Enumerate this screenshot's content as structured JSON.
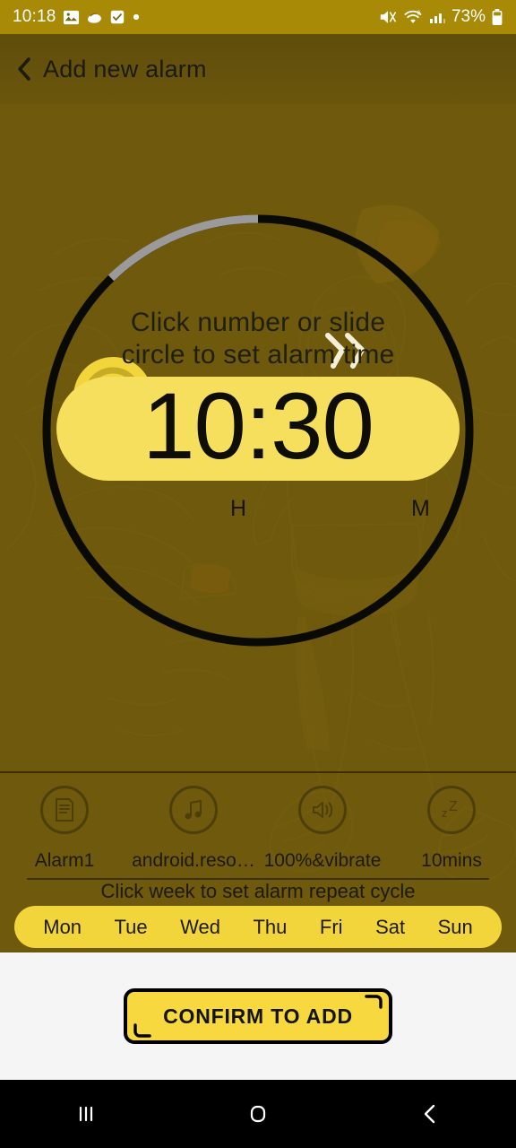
{
  "statusbar": {
    "clock": "10:18",
    "battery": "73%",
    "icons_left": [
      "image-icon",
      "app-icon",
      "checkbox-icon",
      "dot-icon"
    ],
    "icons_right": [
      "mute-icon",
      "wifi-icon",
      "signal-icon",
      "battery-icon"
    ]
  },
  "appbar": {
    "back_icon": "back-chevron-icon",
    "title": "Add new alarm"
  },
  "dial": {
    "hint_line1": "Click number or slide",
    "hint_line2": "circle to set alarm time",
    "time": "10:30",
    "hour_label": "H",
    "minute_label": "M",
    "handle_icon": "dial-handle-knob",
    "direction_icon": "double-chevron-icon",
    "track_color": "#0a0a05",
    "progress_color": "#9a9a9a",
    "knob_color": "#f2d53a",
    "pill_color": "#f5df5c"
  },
  "options": [
    {
      "icon": "document-icon",
      "label": "Alarm1"
    },
    {
      "icon": "music-note-icon",
      "label": "android.reso…"
    },
    {
      "icon": "volume-icon",
      "label": "100%&vibrate"
    },
    {
      "icon": "snooze-zzz-icon",
      "label": "10mins"
    }
  ],
  "week": {
    "hint": "Click week to set alarm repeat cycle",
    "days": [
      "Mon",
      "Tue",
      "Wed",
      "Thu",
      "Fri",
      "Sat",
      "Sun"
    ],
    "pill_color": "#f2d53a"
  },
  "footer": {
    "confirm_label": "CONFIRM TO ADD",
    "confirm_color": "#f7d83f"
  },
  "navbar": {
    "recents_icon": "recents-icon",
    "home_icon": "home-icon",
    "back_icon": "back-icon"
  },
  "theme": {
    "background": "#6b560c",
    "statusbar_bg": "#a88a06",
    "footer_bg": "#f5f5f5",
    "accent": "#f2d53a"
  }
}
